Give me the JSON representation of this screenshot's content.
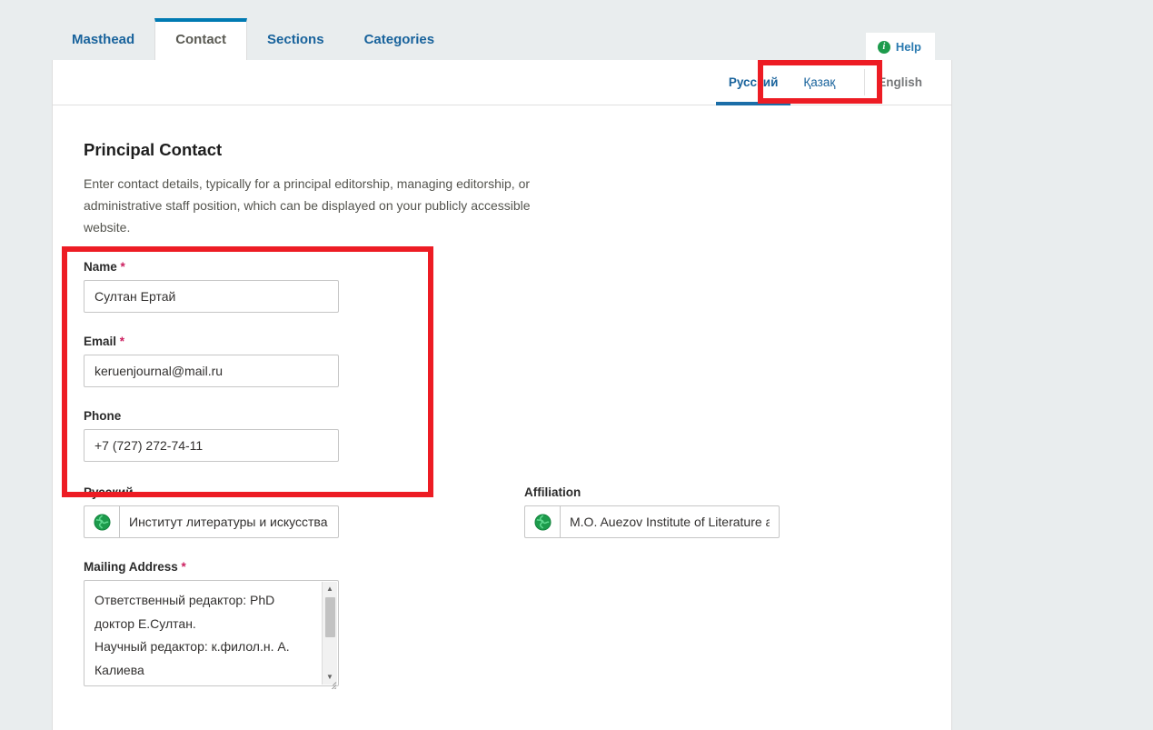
{
  "tabs": [
    {
      "label": "Masthead",
      "active": false
    },
    {
      "label": "Contact",
      "active": true
    },
    {
      "label": "Sections",
      "active": false
    },
    {
      "label": "Categories",
      "active": false
    }
  ],
  "help": {
    "label": "Help",
    "icon": "info-icon",
    "color": "#2a7ab0"
  },
  "language_tabs": [
    {
      "label": "Русский",
      "state": "active"
    },
    {
      "label": "Қазақ",
      "state": "link"
    },
    {
      "label": "English",
      "state": "inactive"
    }
  ],
  "form": {
    "title": "Principal Contact",
    "description": "Enter contact details, typically for a principal editorship, managing editorship, or administrative staff position, which can be displayed on your publicly accessible website.",
    "required_marker": "*",
    "fields": {
      "name": {
        "label": "Name",
        "required": true,
        "value": "Султан Ертай"
      },
      "email": {
        "label": "Email",
        "required": true,
        "value": "keruenjournal@mail.ru"
      },
      "phone": {
        "label": "Phone",
        "required": false,
        "value": "+7 (727) 272-74-11"
      },
      "russian": {
        "label": "Русский",
        "required": false,
        "value": "Институт литературы и искусства",
        "icon": "globe-icon"
      },
      "affiliation": {
        "label": "Affiliation",
        "required": false,
        "value": "M.O. Auezov Institute of Literature and Art",
        "icon": "globe-icon"
      },
      "mailing_address": {
        "label": "Mailing Address",
        "required": true,
        "value": "Ответственный редактор: PhD доктор Е.Султан.\nНаучный редактор: к.филол.н. А. Калиева"
      }
    }
  },
  "annotations": {
    "highlight_color": "#ed1c24",
    "boxes": [
      {
        "name": "language-tabs-highlight"
      },
      {
        "name": "contact-fields-highlight"
      }
    ]
  },
  "colors": {
    "page_background": "#e9edee",
    "panel_background": "#ffffff",
    "tab_link": "#19639c",
    "active_tab_border": "#007ab2",
    "required_asterisk": "#cc1f5f",
    "globe_green": "#1d9b4c"
  }
}
